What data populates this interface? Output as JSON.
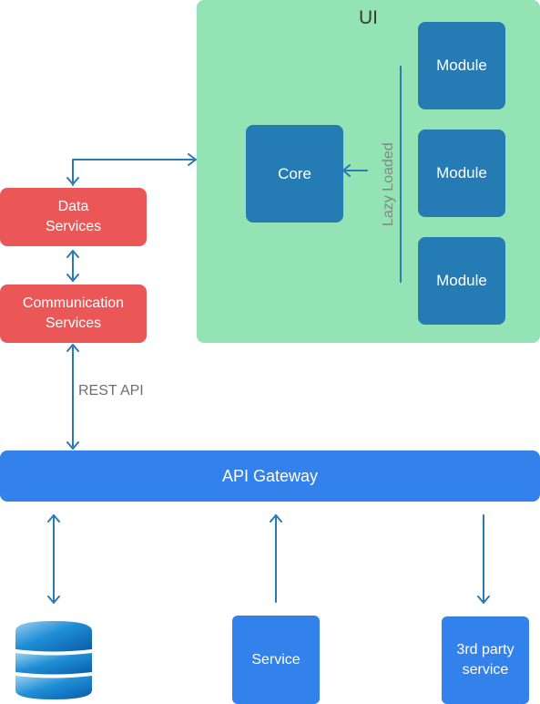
{
  "ui_panel": {
    "title": "UI",
    "color": "#94e3b5"
  },
  "core": {
    "label": "Core",
    "color": "#257bb4"
  },
  "modules": [
    {
      "label": "Module"
    },
    {
      "label": "Module"
    },
    {
      "label": "Module"
    }
  ],
  "lazy_loaded_label": "Lazy Loaded",
  "data_services": {
    "label_line1": "Data",
    "label_line2": "Services",
    "color": "#eb5757"
  },
  "communication_services": {
    "label_line1": "Communication",
    "label_line2": "Services",
    "color": "#eb5757"
  },
  "rest_api_label": "REST API",
  "api_gateway": {
    "label": "API Gateway",
    "color": "#3381ea"
  },
  "database": {
    "icon": "database-icon"
  },
  "service": {
    "label": "Service"
  },
  "third_party": {
    "label_line1": "3rd party",
    "label_line2": "service"
  },
  "arrow_color": "#2a7ab3"
}
